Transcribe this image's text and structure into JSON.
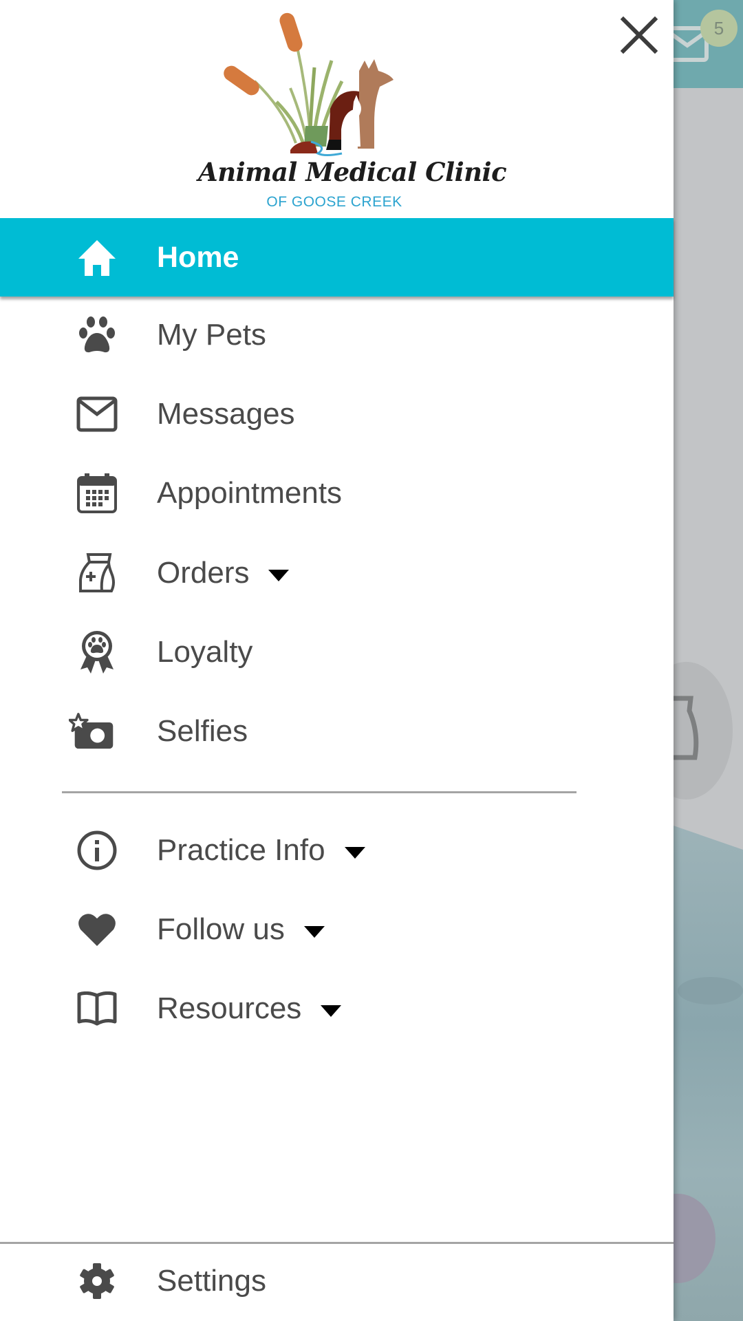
{
  "background_app": {
    "messages_badge_count": "5"
  },
  "drawer": {
    "logo": {
      "title": "Animal Medical Clinic",
      "subtitle": "OF GOOSE CREEK"
    },
    "close_icon": "close-icon",
    "active_color": "#00bcd4",
    "items": [
      {
        "label": "Home",
        "icon": "home-icon",
        "active": true,
        "has_dropdown": false
      },
      {
        "label": "My Pets",
        "icon": "paw-icon",
        "active": false,
        "has_dropdown": false
      },
      {
        "label": "Messages",
        "icon": "envelope-icon",
        "active": false,
        "has_dropdown": false
      },
      {
        "label": "Appointments",
        "icon": "calendar-icon",
        "active": false,
        "has_dropdown": false
      },
      {
        "label": "Orders",
        "icon": "medicine-bag-icon",
        "active": false,
        "has_dropdown": true
      },
      {
        "label": "Loyalty",
        "icon": "award-ribbon-icon",
        "active": false,
        "has_dropdown": false
      },
      {
        "label": "Selfies",
        "icon": "camera-star-icon",
        "active": false,
        "has_dropdown": false
      }
    ],
    "secondary_items": [
      {
        "label": "Practice Info",
        "icon": "info-icon",
        "has_dropdown": true
      },
      {
        "label": "Follow us",
        "icon": "heart-icon",
        "has_dropdown": true
      },
      {
        "label": "Resources",
        "icon": "book-icon",
        "has_dropdown": true
      }
    ],
    "footer_item": {
      "label": "Settings",
      "icon": "gear-icon"
    }
  }
}
